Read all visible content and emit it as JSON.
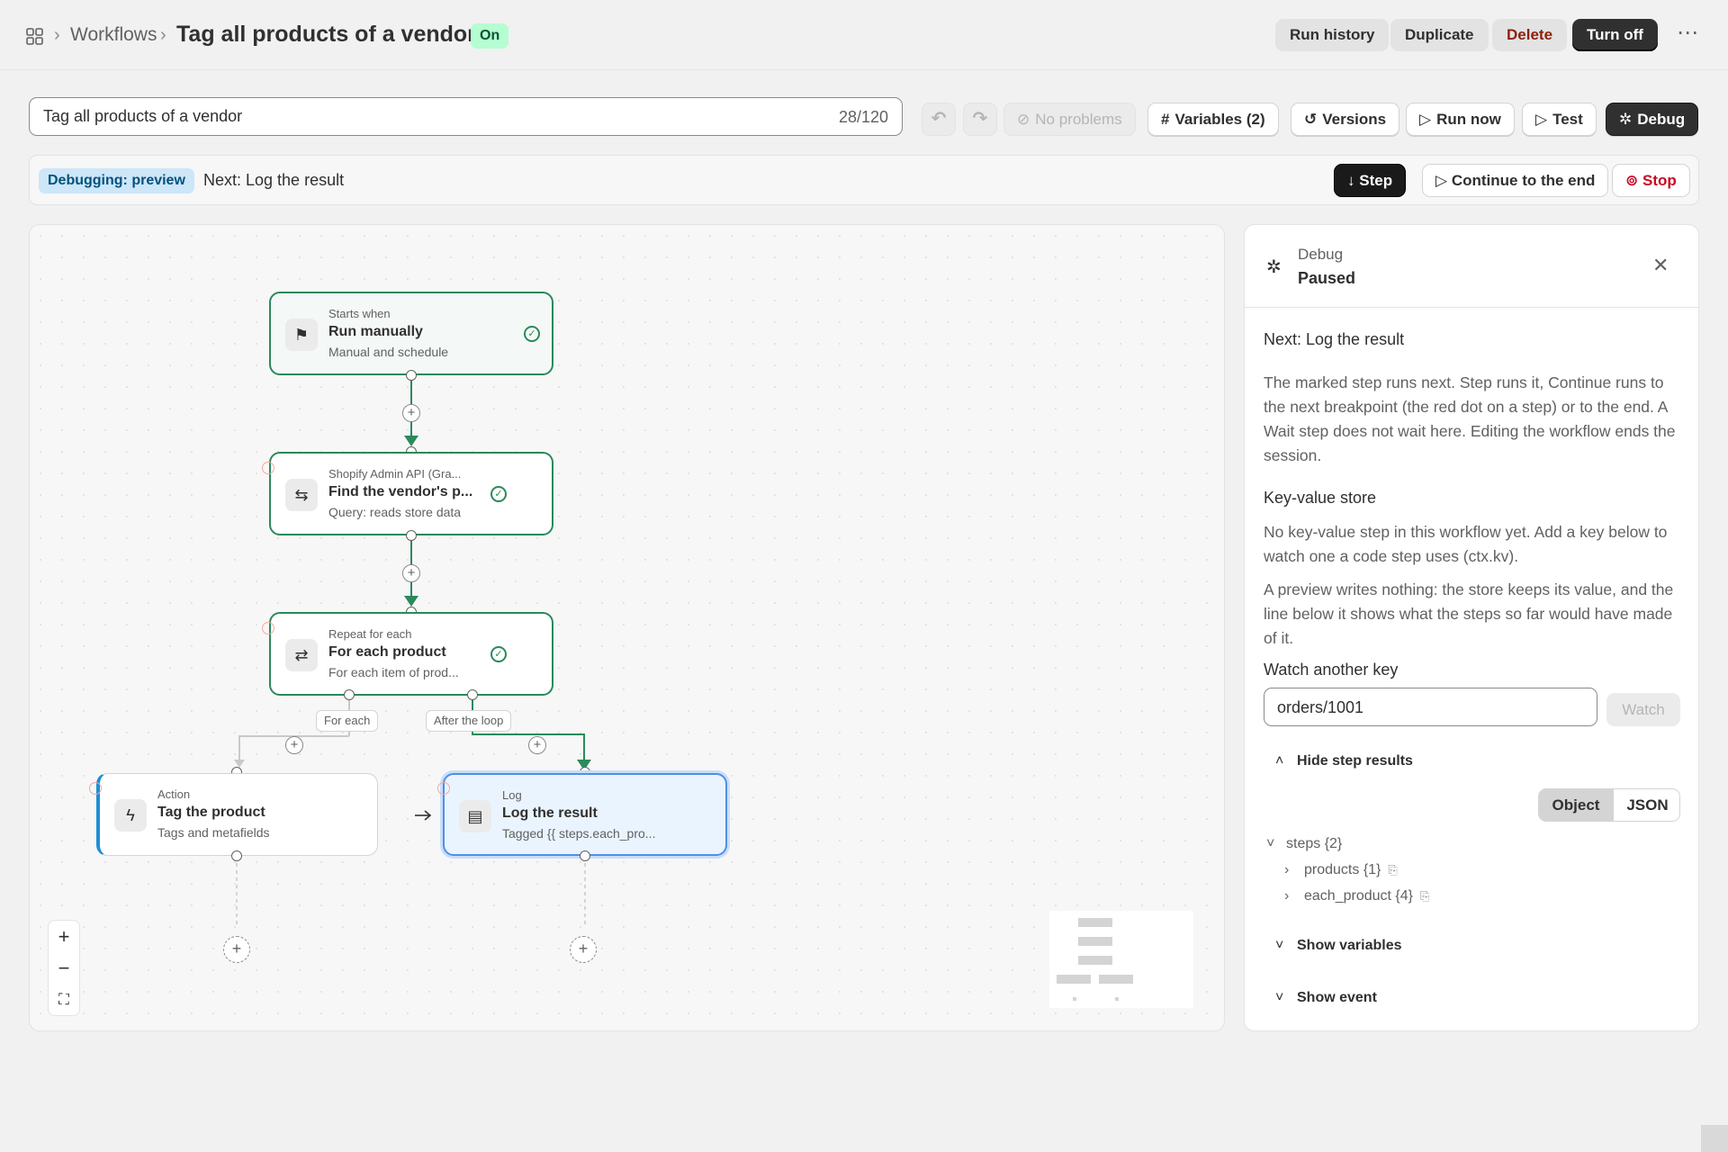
{
  "header": {
    "breadcrumb": "Workflows",
    "title": "Tag all products of a vendor",
    "status_badge": "On",
    "buttons": {
      "run_history": "Run history",
      "duplicate": "Duplicate",
      "delete": "Delete",
      "turn_off": "Turn off"
    }
  },
  "toolbar": {
    "name_value": "Tag all products of a vendor",
    "name_count": "28/120",
    "problems": "No problems",
    "variables": "Variables (2)",
    "versions": "Versions",
    "run_now": "Run now",
    "test": "Test",
    "debug": "Debug"
  },
  "debugbar": {
    "badge": "Debugging: preview",
    "next": "Next: Log the result",
    "step": "Step",
    "continue": "Continue to the end",
    "stop": "Stop"
  },
  "nodes": {
    "trigger": {
      "caption": "Starts when",
      "title": "Run manually",
      "subtitle": "Manual and schedule"
    },
    "query": {
      "caption": "Shopify Admin API (Gra...",
      "title": "Find the vendor's p...",
      "subtitle": "Query: reads store data"
    },
    "loop": {
      "caption": "Repeat for each",
      "title": "For each product",
      "subtitle": "For each item of prod..."
    },
    "action": {
      "caption": "Action",
      "title": "Tag the product",
      "subtitle": "Tags and metafields"
    },
    "log": {
      "caption": "Log",
      "title": "Log the result",
      "subtitle": "Tagged {{ steps.each_pro..."
    }
  },
  "edge_labels": {
    "for_each": "For each",
    "after_loop": "After the loop"
  },
  "panel": {
    "caption": "Debug",
    "status": "Paused",
    "next": "Next: Log the result",
    "description": "The marked step runs next. Step runs it, Continue runs to the next breakpoint (the red dot on a step) or to the end. A Wait step does not wait here. Editing the workflow ends the session.",
    "kv_heading": "Key-value store",
    "kv_empty": "No key-value step in this workflow yet. Add a key below to watch one a code step uses (ctx.kv).",
    "kv_preview": "A preview writes nothing: the store keeps its value, and the line below it shows what the steps so far would have made of it.",
    "watch_label": "Watch another key",
    "watch_value": "orders/1001",
    "watch_button": "Watch",
    "hide_results": "Hide step results",
    "seg_object": "Object",
    "seg_json": "JSON",
    "tree": {
      "root": "steps {2}",
      "items": [
        "products {1}",
        "each_product {4}"
      ]
    },
    "show_variables": "Show variables",
    "show_event": "Show event"
  },
  "colors": {
    "success": "#2a8a5a",
    "selected": "#4f8fe6",
    "danger": "#c70a24",
    "badge_on": "#b4fed2",
    "badge_debug": "#cde6f8"
  },
  "icons": {
    "breadcrumb": "apps-grid-icon",
    "trigger": "flag-icon",
    "query": "api-link-icon",
    "loop": "repeat-icon",
    "action": "lightning-icon",
    "log": "log-note-icon"
  }
}
